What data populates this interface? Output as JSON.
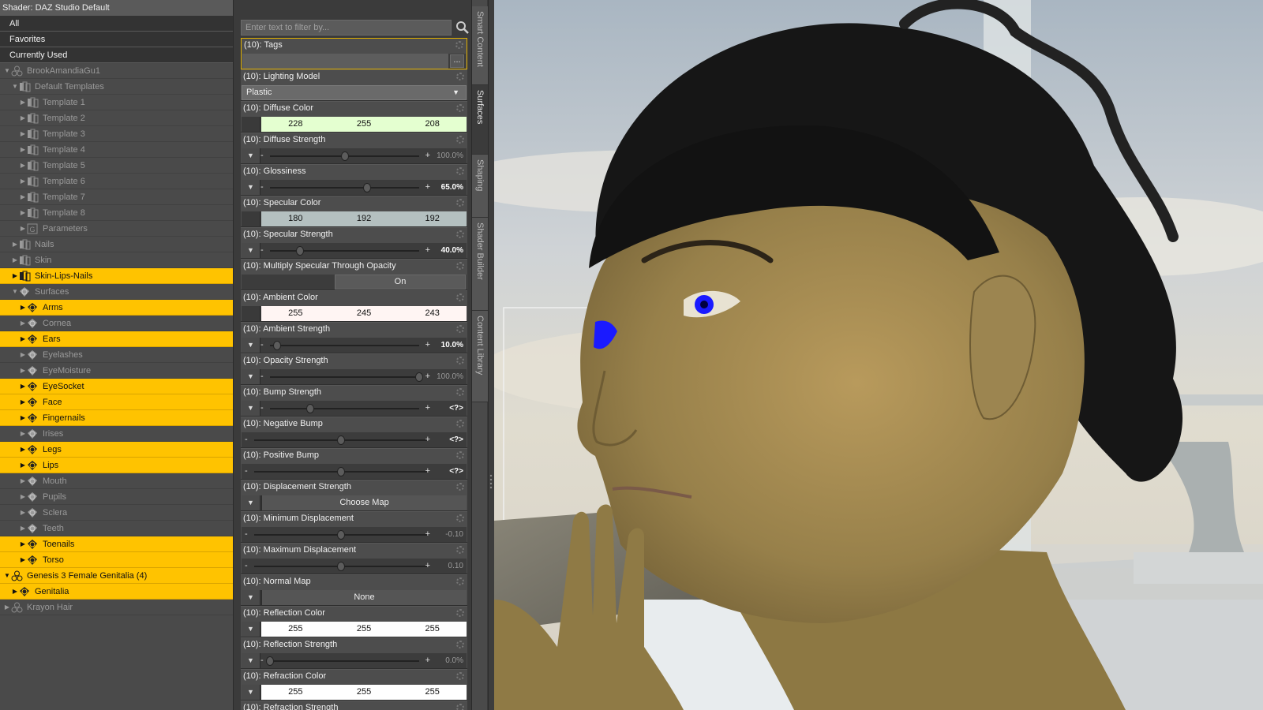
{
  "shader_panel": {
    "title": "Shader: DAZ Studio Default",
    "quick_filters": [
      "All",
      "Favorites",
      "Currently Used"
    ]
  },
  "tree": [
    {
      "label": "BrookAmandiaGu1",
      "level": 0,
      "arrow": "▼",
      "icon": "figure",
      "highlight": false
    },
    {
      "label": "Default Templates",
      "level": 1,
      "arrow": "▼",
      "icon": "folder",
      "highlight": false
    },
    {
      "label": "Template 1",
      "level": 2,
      "arrow": "▶",
      "icon": "folder",
      "highlight": false
    },
    {
      "label": "Template 2",
      "level": 2,
      "arrow": "▶",
      "icon": "folder",
      "highlight": false
    },
    {
      "label": "Template 3",
      "level": 2,
      "arrow": "▶",
      "icon": "folder",
      "highlight": false
    },
    {
      "label": "Template 4",
      "level": 2,
      "arrow": "▶",
      "icon": "folder",
      "highlight": false
    },
    {
      "label": "Template 5",
      "level": 2,
      "arrow": "▶",
      "icon": "folder",
      "highlight": false
    },
    {
      "label": "Template 6",
      "level": 2,
      "arrow": "▶",
      "icon": "folder",
      "highlight": false
    },
    {
      "label": "Template 7",
      "level": 2,
      "arrow": "▶",
      "icon": "folder",
      "highlight": false
    },
    {
      "label": "Template 8",
      "level": 2,
      "arrow": "▶",
      "icon": "folder",
      "highlight": false
    },
    {
      "label": "Parameters",
      "level": 2,
      "arrow": "▶",
      "icon": "param",
      "highlight": false
    },
    {
      "label": "Nails",
      "level": 1,
      "arrow": "▶",
      "icon": "folder",
      "highlight": false
    },
    {
      "label": "Skin",
      "level": 1,
      "arrow": "▶",
      "icon": "folder",
      "highlight": false
    },
    {
      "label": "Skin-Lips-Nails",
      "level": 1,
      "arrow": "▶",
      "icon": "folder",
      "highlight": true
    },
    {
      "label": "Surfaces",
      "level": 1,
      "arrow": "▼",
      "icon": "surface",
      "highlight": false
    },
    {
      "label": "Arms",
      "level": 2,
      "arrow": "▶",
      "icon": "surface",
      "highlight": true
    },
    {
      "label": "Cornea",
      "level": 2,
      "arrow": "▶",
      "icon": "surface",
      "highlight": false
    },
    {
      "label": "Ears",
      "level": 2,
      "arrow": "▶",
      "icon": "surface",
      "highlight": true
    },
    {
      "label": "Eyelashes",
      "level": 2,
      "arrow": "▶",
      "icon": "surface",
      "highlight": false
    },
    {
      "label": "EyeMoisture",
      "level": 2,
      "arrow": "▶",
      "icon": "surface",
      "highlight": false
    },
    {
      "label": "EyeSocket",
      "level": 2,
      "arrow": "▶",
      "icon": "surface",
      "highlight": true
    },
    {
      "label": "Face",
      "level": 2,
      "arrow": "▶",
      "icon": "surface",
      "highlight": true
    },
    {
      "label": "Fingernails",
      "level": 2,
      "arrow": "▶",
      "icon": "surface",
      "highlight": true
    },
    {
      "label": "Irises",
      "level": 2,
      "arrow": "▶",
      "icon": "surface",
      "highlight": false
    },
    {
      "label": "Legs",
      "level": 2,
      "arrow": "▶",
      "icon": "surface",
      "highlight": true
    },
    {
      "label": "Lips",
      "level": 2,
      "arrow": "▶",
      "icon": "surface",
      "highlight": true
    },
    {
      "label": "Mouth",
      "level": 2,
      "arrow": "▶",
      "icon": "surface",
      "highlight": false
    },
    {
      "label": "Pupils",
      "level": 2,
      "arrow": "▶",
      "icon": "surface",
      "highlight": false
    },
    {
      "label": "Sclera",
      "level": 2,
      "arrow": "▶",
      "icon": "surface",
      "highlight": false
    },
    {
      "label": "Teeth",
      "level": 2,
      "arrow": "▶",
      "icon": "surface",
      "highlight": false
    },
    {
      "label": "Toenails",
      "level": 2,
      "arrow": "▶",
      "icon": "surface",
      "highlight": true
    },
    {
      "label": "Torso",
      "level": 2,
      "arrow": "▶",
      "icon": "surface",
      "highlight": true
    },
    {
      "label": "Genesis 3 Female Genitalia (4)",
      "level": 0,
      "arrow": "▼",
      "icon": "figure",
      "highlight": true
    },
    {
      "label": "Genitalia",
      "level": 1,
      "arrow": "▶",
      "icon": "surface",
      "highlight": true
    },
    {
      "label": "Krayon Hair",
      "level": 0,
      "arrow": "▶",
      "icon": "figure",
      "highlight": false
    }
  ],
  "filter": {
    "placeholder": "Enter text to filter by..."
  },
  "properties": [
    {
      "label": "(10): Tags",
      "kind": "tags",
      "button": "...",
      "selected": true
    },
    {
      "label": "(10): Lighting Model",
      "kind": "dropdown",
      "value": "Plastic"
    },
    {
      "label": "(10): Diffuse Color",
      "kind": "color",
      "rgb": [
        "228",
        "255",
        "208"
      ],
      "swatch": "#e4ffd0",
      "caret": false
    },
    {
      "label": "(10): Diffuse Strength",
      "kind": "slider",
      "value": "100.0%",
      "pos": 0.5,
      "bold": false,
      "caret": true
    },
    {
      "label": "(10): Glossiness",
      "kind": "slider",
      "value": "65.0%",
      "pos": 0.65,
      "bold": true,
      "caret": true
    },
    {
      "label": "(10): Specular Color",
      "kind": "color",
      "rgb": [
        "180",
        "192",
        "192"
      ],
      "swatch": "#b4c0c0",
      "caret": false
    },
    {
      "label": "(10): Specular Strength",
      "kind": "slider",
      "value": "40.0%",
      "pos": 0.2,
      "bold": true,
      "caret": true
    },
    {
      "label": "(10): Multiply Specular Through Opacity",
      "kind": "toggle",
      "value": "On"
    },
    {
      "label": "(10): Ambient Color",
      "kind": "color",
      "rgb": [
        "255",
        "245",
        "243"
      ],
      "swatch": "#fff5f3",
      "caret": false
    },
    {
      "label": "(10): Ambient Strength",
      "kind": "slider",
      "value": "10.0%",
      "pos": 0.05,
      "bold": true,
      "caret": true
    },
    {
      "label": "(10): Opacity Strength",
      "kind": "slider",
      "value": "100.0%",
      "pos": 1.0,
      "bold": false,
      "caret": true
    },
    {
      "label": "(10): Bump Strength",
      "kind": "slider",
      "value": "<?>",
      "pos": 0.27,
      "bold": true,
      "caret": true
    },
    {
      "label": "(10): Negative Bump",
      "kind": "slider",
      "value": "<?>",
      "pos": 0.5,
      "bold": true,
      "caret": false
    },
    {
      "label": "(10): Positive Bump",
      "kind": "slider",
      "value": "<?>",
      "pos": 0.5,
      "bold": true,
      "caret": false
    },
    {
      "label": "(10): Displacement Strength",
      "kind": "map",
      "value": "Choose Map"
    },
    {
      "label": "(10): Minimum Displacement",
      "kind": "slider",
      "value": "-0.10",
      "pos": 0.5,
      "bold": false,
      "caret": false
    },
    {
      "label": "(10): Maximum Displacement",
      "kind": "slider",
      "value": "0.10",
      "pos": 0.5,
      "bold": false,
      "caret": false
    },
    {
      "label": "(10): Normal Map",
      "kind": "map",
      "value": "None"
    },
    {
      "label": "(10): Reflection Color",
      "kind": "color",
      "rgb": [
        "255",
        "255",
        "255"
      ],
      "swatch": "#ffffff",
      "caret": true
    },
    {
      "label": "(10): Reflection Strength",
      "kind": "slider",
      "value": "0.0%",
      "pos": 0.0,
      "bold": false,
      "caret": true
    },
    {
      "label": "(10): Refraction Color",
      "kind": "color",
      "rgb": [
        "255",
        "255",
        "255"
      ],
      "swatch": "#ffffff",
      "caret": true
    },
    {
      "label": "(10): Refraction Strength",
      "kind": "slider",
      "value": "",
      "pos": 0.0,
      "bold": false,
      "caret": true
    }
  ],
  "side_tabs": [
    {
      "label": "Smart Content",
      "active": false
    },
    {
      "label": "Surfaces",
      "active": true
    },
    {
      "label": "Shaping",
      "active": false
    },
    {
      "label": "Shader Builder",
      "active": false
    },
    {
      "label": "Content Library",
      "active": false
    }
  ],
  "colors": {
    "highlight": "#ffc300",
    "selected_border": "#e0b000",
    "iris": "#1a1aff"
  }
}
